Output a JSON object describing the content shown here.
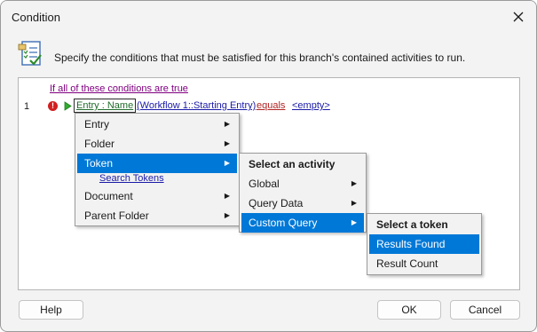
{
  "window": {
    "title": "Condition"
  },
  "header": {
    "instruction": "Specify the conditions that must be satisfied for this branch's contained activities to run."
  },
  "conditions": {
    "header_link": "If all of these conditions are true",
    "rows": [
      {
        "number": "1",
        "field": "Entry : Name",
        "source": "(Workflow 1::Starting Entry)",
        "operator": "equals",
        "value": "<empty>"
      }
    ]
  },
  "menu_main": {
    "items": [
      {
        "label": "Entry",
        "has_submenu": true
      },
      {
        "label": "Folder",
        "has_submenu": true
      },
      {
        "label": "Token",
        "has_submenu": true,
        "selected": true
      },
      {
        "label": "Document",
        "has_submenu": true
      },
      {
        "label": "Parent Folder",
        "has_submenu": true
      }
    ],
    "search_link": "Search Tokens"
  },
  "menu_activity": {
    "heading": "Select an activity",
    "items": [
      {
        "label": "Global",
        "has_submenu": true
      },
      {
        "label": "Query Data",
        "has_submenu": true
      },
      {
        "label": "Custom Query",
        "has_submenu": true,
        "selected": true
      }
    ]
  },
  "menu_token": {
    "heading": "Select a token",
    "items": [
      {
        "label": "Results Found",
        "selected": true
      },
      {
        "label": "Result Count"
      }
    ]
  },
  "footer": {
    "help_label": "Help",
    "ok_label": "OK",
    "cancel_label": "Cancel"
  },
  "colors": {
    "highlight": "#0078d7",
    "link_blue": "#1a1aa8",
    "link_purple": "#800080",
    "operator_red": "#b22222",
    "field_green": "#1f6b2a",
    "error_red": "#d21f1f"
  },
  "icons": {
    "close": "close-icon",
    "header": "checklist-icon",
    "error": "error-icon",
    "play": "play-icon",
    "submenu": "chevron-right-icon"
  }
}
